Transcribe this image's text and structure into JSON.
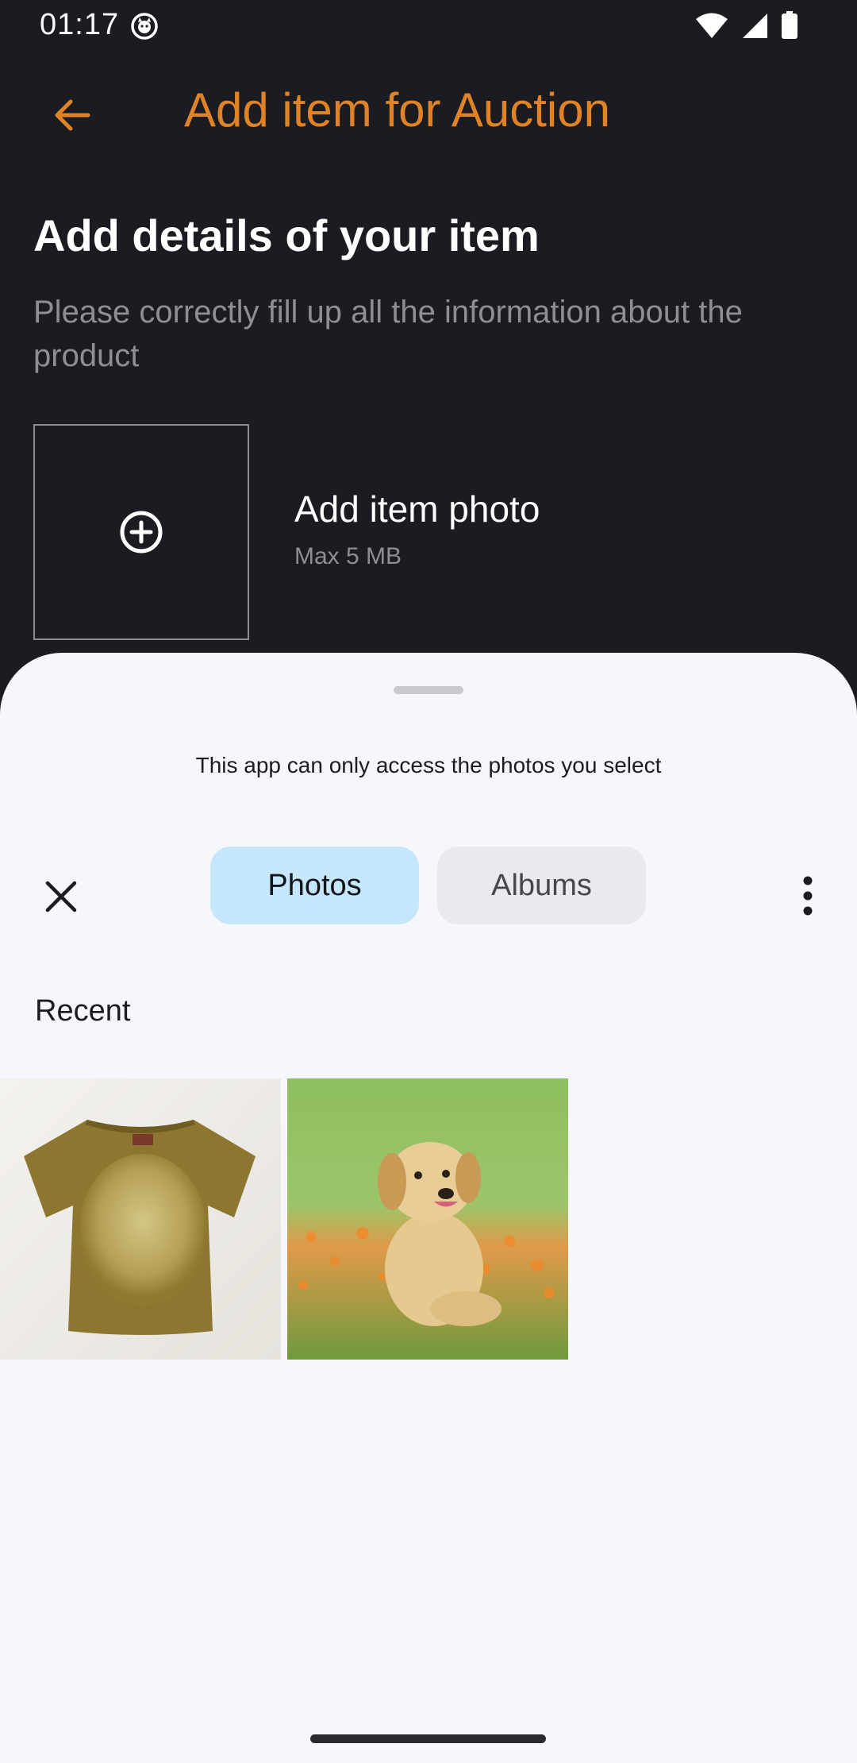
{
  "status_bar": {
    "time": "01:17",
    "icons": [
      "app-notification-icon",
      "wifi-icon",
      "signal-icon",
      "battery-icon"
    ]
  },
  "app_bar": {
    "title": "Add item for Auction",
    "back_icon": "arrow-back-icon"
  },
  "form": {
    "heading": "Add details of your item",
    "description": "Please correctly fill up all the information about the product",
    "photo": {
      "title": "Add item photo",
      "subtitle": "Max 5 MB",
      "icon": "add-circle-icon"
    }
  },
  "picker": {
    "notice": "This app can only access the photos you select",
    "tabs": [
      {
        "label": "Photos",
        "selected": true
      },
      {
        "label": "Albums",
        "selected": false
      }
    ],
    "section_label": "Recent",
    "thumbnails": [
      {
        "name": "t-shirt-photo"
      },
      {
        "name": "puppy-photo"
      }
    ]
  },
  "colors": {
    "background": "#1b1b22",
    "accent": "#e08327",
    "sheet": "#f6f7fc",
    "selected_tab": "#c6e6fb"
  }
}
